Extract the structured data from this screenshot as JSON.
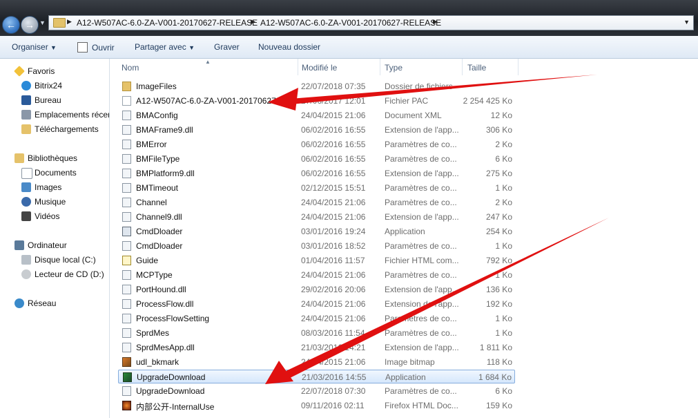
{
  "address": {
    "crumbs": [
      "A12-W507AC-6.0-ZA-V001-20170627-RELEASE",
      "A12-W507AC-6.0-ZA-V001-20170627-RELEASE"
    ]
  },
  "toolbar": {
    "organize": "Organiser",
    "open": "Ouvrir",
    "share": "Partager avec",
    "burn": "Graver",
    "new_folder": "Nouveau dossier"
  },
  "nav": {
    "favorites": "Favoris",
    "bitrix": "Bitrix24",
    "desktop": "Bureau",
    "recent": "Emplacements récer",
    "downloads": "Téléchargements",
    "libraries": "Bibliothèques",
    "documents": "Documents",
    "images": "Images",
    "music": "Musique",
    "videos": "Vidéos",
    "computer": "Ordinateur",
    "local_disk": "Disque local (C:)",
    "cd_drive": "Lecteur de CD (D:)",
    "network": "Réseau"
  },
  "columns": {
    "name": "Nom",
    "modified": "Modifié le",
    "type": "Type",
    "size": "Taille"
  },
  "files": [
    {
      "name": "ImageFiles",
      "date": "22/07/2018 07:35",
      "type": "Dossier de fichiers",
      "size": "",
      "icon": "folder"
    },
    {
      "name": "A12-W507AC-6.0-ZA-V001-20170627",
      "date": "27/06/2017 12:01",
      "type": "Fichier PAC",
      "size": "2 254 425 Ko",
      "icon": "doc"
    },
    {
      "name": "BMAConfig",
      "date": "24/04/2015 21:06",
      "type": "Document XML",
      "size": "12 Ko",
      "icon": "gear"
    },
    {
      "name": "BMAFrame9.dll",
      "date": "06/02/2016 16:55",
      "type": "Extension de l'app...",
      "size": "306 Ko",
      "icon": "gear"
    },
    {
      "name": "BMError",
      "date": "06/02/2016 16:55",
      "type": "Paramètres de co...",
      "size": "2 Ko",
      "icon": "gear"
    },
    {
      "name": "BMFileType",
      "date": "06/02/2016 16:55",
      "type": "Paramètres de co...",
      "size": "6 Ko",
      "icon": "gear"
    },
    {
      "name": "BMPlatform9.dll",
      "date": "06/02/2016 16:55",
      "type": "Extension de l'app...",
      "size": "275 Ko",
      "icon": "gear"
    },
    {
      "name": "BMTimeout",
      "date": "02/12/2015 15:51",
      "type": "Paramètres de co...",
      "size": "1 Ko",
      "icon": "gear"
    },
    {
      "name": "Channel",
      "date": "24/04/2015 21:06",
      "type": "Paramètres de co...",
      "size": "2 Ko",
      "icon": "gear"
    },
    {
      "name": "Channel9.dll",
      "date": "24/04/2015 21:06",
      "type": "Extension de l'app...",
      "size": "247 Ko",
      "icon": "gear"
    },
    {
      "name": "CmdDloader",
      "date": "03/01/2016 19:24",
      "type": "Application",
      "size": "254 Ko",
      "icon": "app"
    },
    {
      "name": "CmdDloader",
      "date": "03/01/2016 18:52",
      "type": "Paramètres de co...",
      "size": "1 Ko",
      "icon": "gear"
    },
    {
      "name": "Guide",
      "date": "01/04/2016 11:57",
      "type": "Fichier HTML com...",
      "size": "792 Ko",
      "icon": "html"
    },
    {
      "name": "MCPType",
      "date": "24/04/2015 21:06",
      "type": "Paramètres de co...",
      "size": "1 Ko",
      "icon": "gear"
    },
    {
      "name": "PortHound.dll",
      "date": "29/02/2016 20:06",
      "type": "Extension de l'app...",
      "size": "136 Ko",
      "icon": "gear"
    },
    {
      "name": "ProcessFlow.dll",
      "date": "24/04/2015 21:06",
      "type": "Extension de l'app...",
      "size": "192 Ko",
      "icon": "gear"
    },
    {
      "name": "ProcessFlowSetting",
      "date": "24/04/2015 21:06",
      "type": "Paramètres de co...",
      "size": "1 Ko",
      "icon": "gear"
    },
    {
      "name": "SprdMes",
      "date": "08/03/2016 11:54",
      "type": "Paramètres de co...",
      "size": "1 Ko",
      "icon": "gear"
    },
    {
      "name": "SprdMesApp.dll",
      "date": "21/03/2016 14:21",
      "type": "Extension de l'app...",
      "size": "1 811 Ko",
      "icon": "gear"
    },
    {
      "name": "udl_bkmark",
      "date": "24/04/2015 21:06",
      "type": "Image bitmap",
      "size": "118 Ko",
      "icon": "img"
    },
    {
      "name": "UpgradeDownload",
      "date": "21/03/2016 14:55",
      "type": "Application",
      "size": "1 684 Ko",
      "icon": "dl",
      "selected": true
    },
    {
      "name": "UpgradeDownload",
      "date": "22/07/2018 07:30",
      "type": "Paramètres de co...",
      "size": "6 Ko",
      "icon": "gear"
    },
    {
      "name": "内部公开-InternalUse",
      "date": "09/11/2016 02:11",
      "type": "Firefox HTML Doc...",
      "size": "159 Ko",
      "icon": "fox"
    }
  ],
  "colors": {
    "arrow": "#e01010",
    "selection": "#cce4fc",
    "header_text": "#4c607a"
  }
}
